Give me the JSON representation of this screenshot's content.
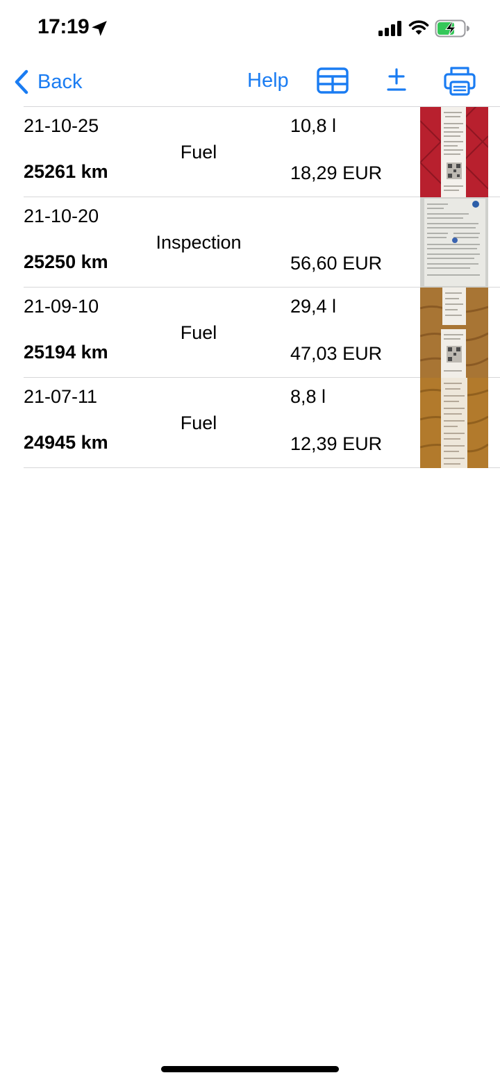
{
  "status_bar": {
    "time": "17:19"
  },
  "nav": {
    "back_label": "Back",
    "help_label": "Help",
    "accent_color": "#1a7cf2"
  },
  "entries": [
    {
      "date": "21-10-25",
      "km": "25261 km",
      "type": "Fuel",
      "quantity": "10,8 l",
      "cost": "18,29 EUR"
    },
    {
      "date": "21-10-20",
      "km": "25250 km",
      "type": "Inspection",
      "quantity": "",
      "cost": "56,60 EUR"
    },
    {
      "date": "21-09-10",
      "km": "25194 km",
      "type": "Fuel",
      "quantity": "29,4 l",
      "cost": "47,03 EUR"
    },
    {
      "date": "21-07-11",
      "km": "24945 km",
      "type": "Fuel",
      "quantity": "8,8 l",
      "cost": "12,39 EUR"
    }
  ]
}
